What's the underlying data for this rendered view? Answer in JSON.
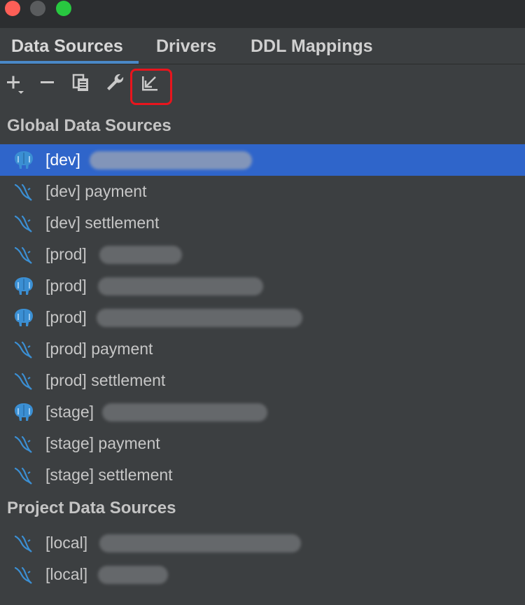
{
  "window": {
    "colors": {
      "close": "#fe5f57",
      "minimize": "#5a5c5e",
      "maximize": "#28c840",
      "accent": "#4a88c7",
      "selection": "#2f65ca",
      "highlight_box": "#e8151d"
    }
  },
  "tabs": [
    {
      "label": "Data Sources",
      "active": true
    },
    {
      "label": "Drivers",
      "active": false
    },
    {
      "label": "DDL Mappings",
      "active": false
    }
  ],
  "toolbar": {
    "buttons": [
      {
        "icon": "add-icon",
        "glyph": "+"
      },
      {
        "icon": "remove-icon",
        "glyph": "−"
      },
      {
        "icon": "duplicate-icon"
      },
      {
        "icon": "wrench-icon"
      },
      {
        "icon": "import-arrow-icon"
      }
    ]
  },
  "global": {
    "header": "Global Data Sources",
    "items": [
      {
        "label": "[dev]",
        "db": "postgresql",
        "selected": true,
        "redacted": true
      },
      {
        "label": "[dev] payment",
        "db": "mysql",
        "selected": false,
        "redacted": false
      },
      {
        "label": "[dev] settlement",
        "db": "mysql",
        "selected": false,
        "redacted": false
      },
      {
        "label": "[prod]",
        "db": "mysql",
        "selected": false,
        "redacted": true
      },
      {
        "label": "[prod]",
        "db": "postgresql",
        "selected": false,
        "redacted": true
      },
      {
        "label": "[prod]",
        "db": "postgresql",
        "selected": false,
        "redacted": true
      },
      {
        "label": "[prod] payment",
        "db": "mysql",
        "selected": false,
        "redacted": false
      },
      {
        "label": "[prod] settlement",
        "db": "mysql",
        "selected": false,
        "redacted": false
      },
      {
        "label": "[stage]",
        "db": "postgresql",
        "selected": false,
        "redacted": true
      },
      {
        "label": "[stage] payment",
        "db": "mysql",
        "selected": false,
        "redacted": false
      },
      {
        "label": "[stage] settlement",
        "db": "mysql",
        "selected": false,
        "redacted": false
      }
    ]
  },
  "project": {
    "header": "Project Data Sources",
    "items": [
      {
        "label": "[local]",
        "db": "mysql",
        "selected": false,
        "redacted": true
      },
      {
        "label": "[local]",
        "db": "mysql",
        "selected": false,
        "redacted": true
      }
    ]
  }
}
